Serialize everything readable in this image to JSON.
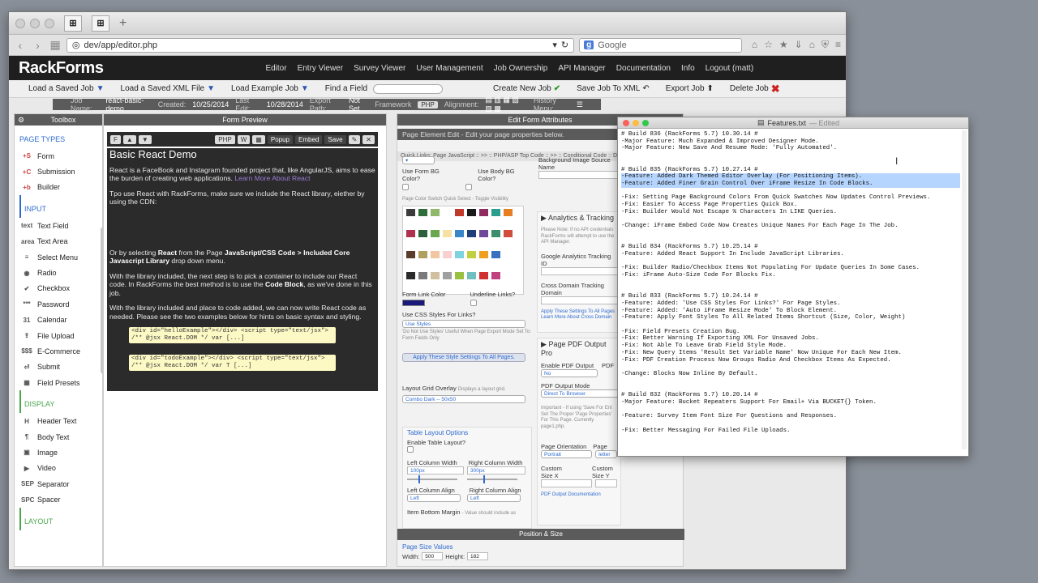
{
  "browser": {
    "url": "dev/app/editor.php",
    "search_placeholder": "Google",
    "search_engine_badge": "g"
  },
  "app": {
    "logo": "RackForms",
    "nav": [
      "Editor",
      "Entry Viewer",
      "Survey Viewer",
      "User Management",
      "Job Ownership",
      "API Manager",
      "Documentation",
      "Info",
      "Logout (matt)"
    ]
  },
  "toolbar": {
    "load_saved_job": "Load a Saved Job",
    "load_saved_xml": "Load a Saved XML File",
    "load_example_job": "Load Example Job",
    "find_field": "Find a Field",
    "create_new_job": "Create New Job",
    "save_job_xml": "Save Job To XML",
    "export_job": "Export Job",
    "delete_job": "Delete Job"
  },
  "jobbar": {
    "job_name_label": "Job Name:",
    "job_name": "react-basic-demo",
    "created_label": "Created:",
    "created": "10/25/2014",
    "last_edit_label": "Last Edit:",
    "last_edit": "10/28/2014",
    "export_path_label": "Export Path:",
    "export_path": "Not Set",
    "framework_label": "Framework",
    "framework": "PHP",
    "alignment_label": "Alignment:",
    "history_label": "History Menu:"
  },
  "toolbox": {
    "title": "Toolbox",
    "page_types_label": "PAGE TYPES",
    "page_types": [
      {
        "icon": "+S",
        "label": "Form"
      },
      {
        "icon": "+C",
        "label": "Submission"
      },
      {
        "icon": "+b",
        "label": "Builder"
      }
    ],
    "input_label": "INPUT",
    "input_items": [
      {
        "icon": "text",
        "label": "Text Field"
      },
      {
        "icon": "area",
        "label": "Text Area"
      },
      {
        "icon": "≡",
        "label": "Select Menu"
      },
      {
        "icon": "◉",
        "label": "Radio"
      },
      {
        "icon": "✔",
        "label": "Checkbox"
      },
      {
        "icon": "***",
        "label": "Password"
      },
      {
        "icon": "31",
        "label": "Calendar"
      },
      {
        "icon": "⇪",
        "label": "File Upload"
      },
      {
        "icon": "$$$",
        "label": "E-Commerce"
      },
      {
        "icon": "⏎",
        "label": "Submit"
      },
      {
        "icon": "▦",
        "label": "Field Presets"
      }
    ],
    "display_label": "DISPLAY",
    "display_items": [
      {
        "icon": "H",
        "label": "Header Text"
      },
      {
        "icon": "¶",
        "label": "Body Text"
      },
      {
        "icon": "▣",
        "label": "Image"
      },
      {
        "icon": "▶",
        "label": "Video"
      },
      {
        "icon": "SEP",
        "label": "Separator"
      },
      {
        "icon": "SPC",
        "label": "Spacer"
      }
    ],
    "layout_label": "LAYOUT"
  },
  "preview": {
    "title": "Form Preview",
    "f_button": "F",
    "popup": "Popup",
    "embed": "Embed",
    "save": "Save",
    "heading": "Basic React Demo",
    "p1": "React is a FaceBook and Instagram founded project that, like AngularJS, aims to ease the burden of creating web applications.",
    "p1_link": "Learn More About React",
    "p2": "Tpo use React with RackForms, make sure we include the React library, eiether by using the CDN:",
    "p3_a": "Or by selecting ",
    "p3_b": "React",
    "p3_c": " from the Page ",
    "p3_d": "JavaScript/CSS Code > Included Core Javascript Library",
    "p3_e": " drop down menu.",
    "p4_a": "With the library included, the next step is to pick a container to include our React code. In RackForms the best method is to use the ",
    "p4_b": "Code Block",
    "p4_c": ", as we've done in this job.",
    "p5": "With the library included and place to code added, we can now write React code as needed. Please see the two examples below for hints on basic syntax and styling.",
    "code1": "<div id=\"helloExample\"></div> <script type=\"text/jsx\"> /** @jsx React.DOM */ var [...]",
    "code2": "<div id=\"todoExample\"></div> <script type=\"text/jsx\"> /** @jsx React.DOM */ var T [...]"
  },
  "attrs": {
    "title": "Edit Form Attributes",
    "subtitle": "Page Element Edit - Edit your page properties below.",
    "quick_links": "Quick Links: Page JavaScript :: >> :: PHP/ASP Top Code :: >> :: Conditional Code :: Data",
    "use_form_bg": "Use Form BG Color?",
    "use_body_bg": "Use Body BG Color?",
    "bg_image_source": "Background Image Source Name",
    "swatch_label": "Page Color Switch Quick Select - Toggle Visibility",
    "analytics_title": "Analytics & Tracking",
    "analytics_note": "Please Note: If no API credentials RackForms will attempt to use the API Manager.",
    "ga_id": "Google Analytics Tracking ID",
    "cross_domain": "Cross Domain Tracking Domain",
    "apply_these": "Apply These Settings To All Pages",
    "learn_more_cross": "Learn More About Cross Domain",
    "form_link_color": "Form Link Color",
    "underline_links": "Underline Links?",
    "use_css_styles": "Use CSS Styles For Links?",
    "use_styles_value": "Use Styles",
    "use_styles_note": "'Do Not Use Styles' Useful When Page Export Mode Set To: Form Fields Only",
    "apply_style_btn": "Apply These Style Settings To All Pages.",
    "layout_grid": "Layout Grid Overlay",
    "layout_grid_note": "Displays a layout grid.",
    "layout_grid_value": "Combo Dark -- 50x50",
    "pdf_title": "Page PDF Output Pro",
    "enable_pdf": "Enable PDF Output",
    "pdf_label": "PDF",
    "pdf_value": "No",
    "pdf_mode": "PDF Output Mode",
    "pdf_mode_value": "Direct To Browser",
    "pdf_note": "Important - If using 'Save For Ent Set The Proper 'Page Properties' For This Page. Currently page1.php.",
    "table_layout": "Table Layout Options",
    "enable_table": "Enable Table Layout?",
    "left_col_width": "Left Column Width",
    "right_col_width": "Right Column Width",
    "left_width_val": "100px",
    "right_width_val": "300px",
    "left_align": "Left Column Align",
    "right_align": "Right Column Align",
    "left_align_val": "Left",
    "right_align_val": "Left",
    "item_bottom": "Item Bottom Margin",
    "item_bottom_note": "- Value should include as",
    "page_orientation": "Page Orientation",
    "page_orientation_val": "Portrait",
    "page_label": "Page",
    "page_val": "letter",
    "custom_x": "Custom Size X",
    "custom_y": "Custom Size Y",
    "pdf_doc": "PDF Output Documentation",
    "position_size": "Position & Size",
    "page_size_values": "Page Size Values",
    "width_label": "Width:",
    "width_val": "500",
    "height_label": "Height:",
    "height_val": "182"
  },
  "swatches": [
    "#3b3b3b",
    "#2f6d3a",
    "#8fb86b",
    "#ffffff",
    "#c0392b",
    "#1a1a1a",
    "#8e2b5f",
    "#2a9d8f",
    "#e67e22",
    "#ffffff",
    "#b03050",
    "#2d5f3a",
    "#6aa84f",
    "#f5e1a4",
    "#3a86c8",
    "#1f3f7a",
    "#6e4b9a",
    "#3e8e6e",
    "#d04d3d",
    "#ffffff",
    "#5b3b2b",
    "#b0a060",
    "#f2c6a0",
    "#f8d0d0",
    "#7dd3e0",
    "#c0d040",
    "#f0a020",
    "#3a70c0",
    "#ffffff",
    "#ffffff",
    "#2b2b2b",
    "#7a7a7a",
    "#d0c0a0",
    "#a0a0a0",
    "#9ac040",
    "#70c0c0",
    "#d03030",
    "#c04080",
    "#ffffff",
    "#ffffff"
  ],
  "textfile": {
    "name": "Features.txt",
    "status": "— Edited",
    "lines_before": "# Build 836 (RackForms 5.7) 10.30.14 #\n-Major Feature: Much Expanded & Improved Designer Mode.\n-Major Feature: New Save And Resume Mode: 'Fully Automated'.\n\n\n# Build 835 (RackForms 5.7) 10.27.14 #",
    "highlight1": "-Feature: Added Dark Themed Editor Overlay (For Positioning Items).",
    "highlight2": "-Feature: Added Finer Grain Control Over iFrame Resize In Code Blocks.",
    "lines_after": "\n-Fix: Setting Page Background Colors From Quick Swatches Now Updates Control Previews.\n-Fix: Easier To Access Page Properties Quick Box.\n-Fix: Builder Would Not Escape % Characters In LIKE Queries.\n\n-Change: iFrame Embed Code Now Creates Unique Names For Each Page In The Job.\n\n\n# Build 834 (RackForms 5.7) 10.25.14 #\n-Feature: Added React Support In Include JavaScript Libraries.\n\n-Fix: Builder Radio/Checkbox Items Not Populating For Update Queries In Some Cases.\n-Fix: iFrame Auto-Size Code For Blocks Fix.\n\n\n# Build 833 (RackForms 5.7) 10.24.14 #\n-Feature: Added: 'Use CSS Styles For Links?' For Page Styles.\n-Feature: Added: 'Auto iFrame Resize Mode' To Block Element.\n-Feature: Apply Font Styles To All Related Items Shortcut (Size, Color, Weight)\n\n-Fix: Field Presets Creation Bug.\n-Fix: Better Warning If Exporting XML For Unsaved Jobs.\n-Fix: Not Able To Leave Grab Field Style Mode.\n-Fix: New Query Items 'Result Set Variable Name' Now Unique For Each New Item.\n-Fix: PDF Creation Process Now Groups Radio And Checkbox Items As Expected.\n\n-Change: Blocks Now Inline By Default.\n\n\n# Build 832 (RackForms 5.7) 10.20.14 #\n-Major Feature: Bucket Repeaters Support For Email+ Via BUCKET{} Token.\n\n-Feature: Survey Item Font Size For Questions and Responses.\n\n-Fix: Better Messaging For Failed File Uploads."
  }
}
